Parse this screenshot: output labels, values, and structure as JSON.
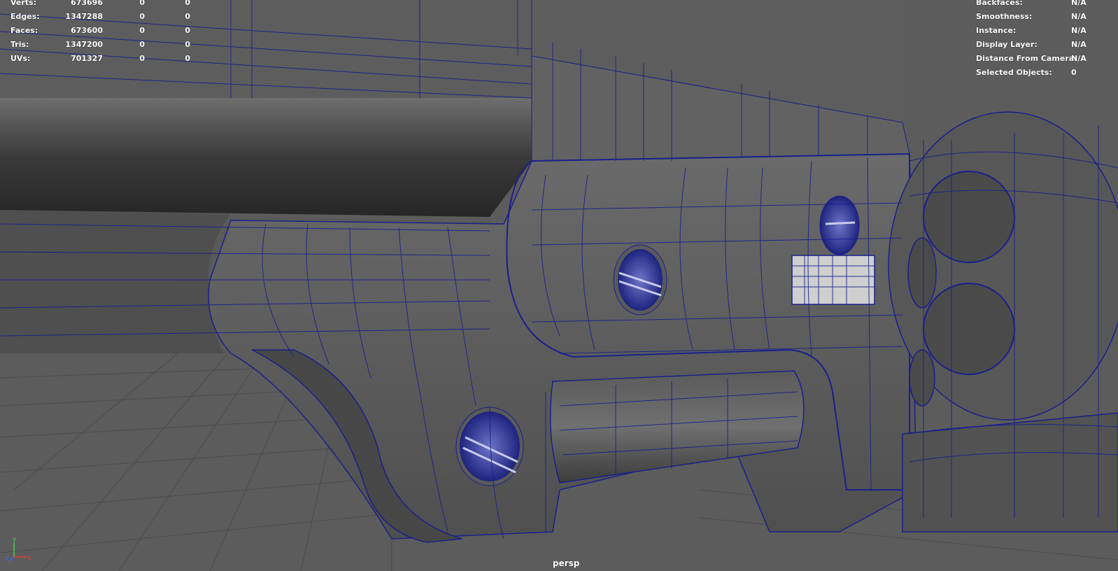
{
  "hud_left": {
    "rows": [
      {
        "label": "Verts:",
        "total": "673696",
        "selected": "0",
        "component": "0"
      },
      {
        "label": "Edges:",
        "total": "1347288",
        "selected": "0",
        "component": "0"
      },
      {
        "label": "Faces:",
        "total": "673600",
        "selected": "0",
        "component": "0"
      },
      {
        "label": "Tris:",
        "total": "1347200",
        "selected": "0",
        "component": "0"
      },
      {
        "label": "UVs:",
        "total": "701327",
        "selected": "0",
        "component": "0"
      }
    ]
  },
  "hud_right": {
    "rows": [
      {
        "label": "Backfaces:",
        "value": "N/A"
      },
      {
        "label": "Smoothness:",
        "value": "N/A"
      },
      {
        "label": "Instance:",
        "value": "N/A"
      },
      {
        "label": "Display Layer:",
        "value": "N/A"
      },
      {
        "label": "Distance From Camera:",
        "value": "N/A"
      },
      {
        "label": "Selected Objects:",
        "value": "0"
      }
    ]
  },
  "camera": {
    "label": "persp"
  },
  "axis_gizmo": {
    "x": "x",
    "y": "y",
    "z": "z"
  },
  "colors": {
    "background": "#5a5a5a",
    "wireframe": "#1a1f8c",
    "grid": "#4a4a4a"
  }
}
